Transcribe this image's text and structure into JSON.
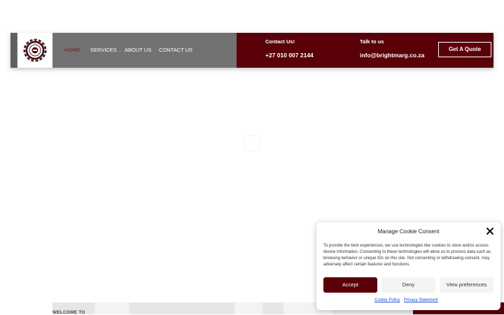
{
  "colors": {
    "brand_dark_red": "#5a0009",
    "nav_grey": "#727272",
    "active_nav": "#8a0f14"
  },
  "header": {
    "logo": "gear-logo-icon",
    "nav": [
      {
        "label": "HOME",
        "active": true
      },
      {
        "label": "SERVICES",
        "has_dropdown": true
      },
      {
        "label": "ABOUT US"
      },
      {
        "label": "CONTACT US"
      }
    ],
    "contact": {
      "label": "Contact Us!",
      "value": "+27 010 007 2144"
    },
    "email": {
      "label": "Talk to us",
      "value": "info@brightmarg.co.za"
    },
    "cta": "Get A Quote"
  },
  "hero": {
    "welcome": "WELCOME TO"
  },
  "cookie_modal": {
    "title": "Manage Cookie Consent",
    "body": "To provide the best experiences, we use technologies like cookies to store and/or access device information. Consenting to these technologies will allow us to process data such as browsing behavior or unique IDs on this site. Not consenting or withdrawing consent, may adversely affect certain features and functions.",
    "accept": "Accept",
    "deny": "Deny",
    "preferences": "View preferences",
    "links": [
      "Cookie Policy",
      "Privacy Statement"
    ]
  }
}
